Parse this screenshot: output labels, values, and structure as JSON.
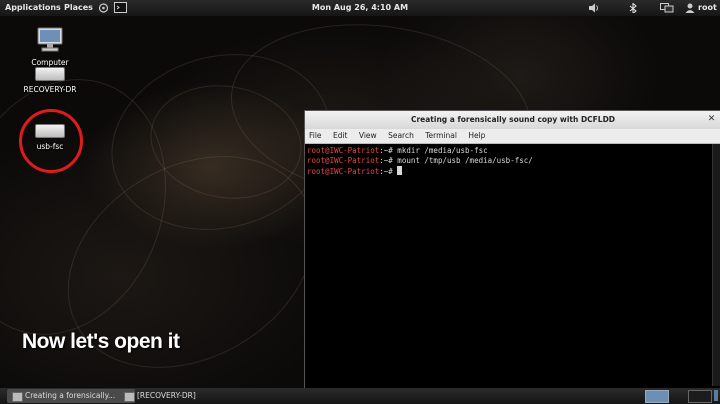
{
  "top_panel": {
    "applications_label": "Applications",
    "places_label": "Places",
    "clock": "Mon Aug 26,  4:10 AM",
    "user": "root"
  },
  "desktop": {
    "icons": [
      {
        "label": "Computer",
        "icon": "computer-icon"
      },
      {
        "label": "RECOVERY-DR",
        "icon": "drive-icon"
      },
      {
        "label": "usb-fsc",
        "icon": "drive-icon"
      }
    ],
    "caption": "Now let's open it",
    "highlight_color": "#e01b1b"
  },
  "terminal": {
    "title": "Creating a forensically sound copy with DCFLDD",
    "menu": [
      "File",
      "Edit",
      "View",
      "Search",
      "Terminal",
      "Help"
    ],
    "lines": [
      {
        "prompt": "root@IWC-Patriot",
        "rest": ":~# mkdir /media/usb-fsc"
      },
      {
        "prompt": "root@IWC-Patriot",
        "rest": ":~# mount /tmp/usb /media/usb-fsc/"
      },
      {
        "prompt": "root@IWC-Patriot",
        "rest": ":~# "
      }
    ],
    "prompt_color": "#e84646"
  },
  "taskbar": {
    "tasks": [
      {
        "label": "Creating a forensically..."
      },
      {
        "label": "[RECOVERY-DR]"
      }
    ]
  }
}
